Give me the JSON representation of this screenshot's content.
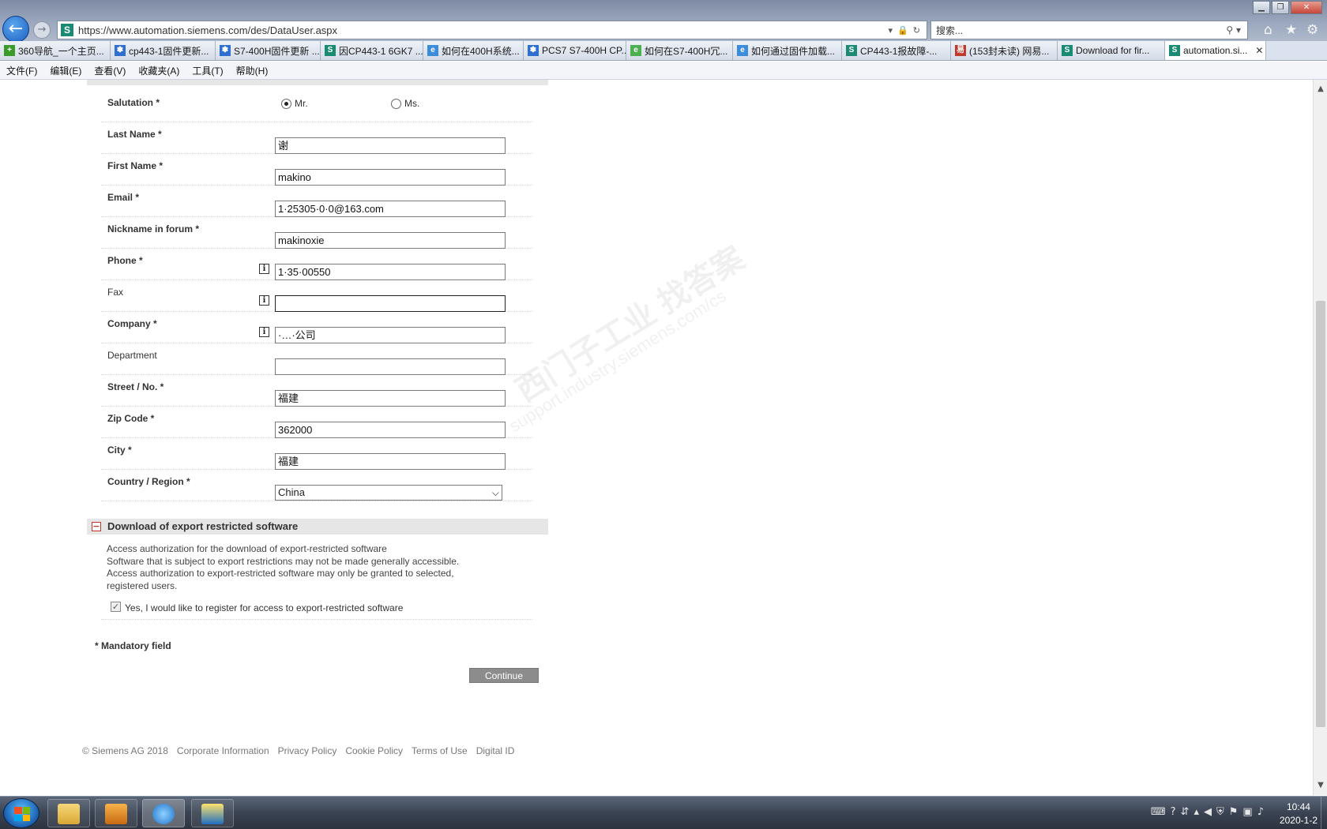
{
  "browser": {
    "url": "https://www.automation.siemens.com/des/DataUser.aspx",
    "search_placeholder": "搜索...",
    "tabs": [
      {
        "label": "360导航_一个主页...",
        "icon_color": "#3a9b2a",
        "icon_char": "+"
      },
      {
        "label": "cp443-1固件更新...",
        "icon_color": "#2f6fd0",
        "icon_char": "✽"
      },
      {
        "label": "S7-400H固件更新 ...",
        "icon_color": "#2f6fd0",
        "icon_char": "✽"
      },
      {
        "label": "因CP443-1 6GK7 ...",
        "icon_color": "#1b8a72",
        "icon_char": "S"
      },
      {
        "label": "如何在400H系统...",
        "icon_color": "#3a8ddd",
        "icon_char": "e"
      },
      {
        "label": "PCS7 S7-400H CP...",
        "icon_color": "#2f6fd0",
        "icon_char": "✽"
      },
      {
        "label": "如何在S7-400H冗...",
        "icon_color": "#4caf50",
        "icon_char": "e"
      },
      {
        "label": "如何通过固件加载...",
        "icon_color": "#3a8ddd",
        "icon_char": "e"
      },
      {
        "label": "CP443-1报故障-...",
        "icon_color": "#1b8a72",
        "icon_char": "S"
      },
      {
        "label": "(153封未读) 网易...",
        "icon_color": "#c0392b",
        "icon_char": "易"
      },
      {
        "label": "Download for fir...",
        "icon_color": "#1b8a72",
        "icon_char": "S"
      },
      {
        "label": "automation.si...",
        "icon_color": "#1b8a72",
        "icon_char": "S",
        "active": true
      }
    ],
    "menu": [
      "文件(F)",
      "编辑(E)",
      "查看(V)",
      "收藏夹(A)",
      "工具(T)",
      "帮助(H)"
    ]
  },
  "form": {
    "salutation": {
      "label": "Salutation *",
      "options": [
        "Mr.",
        "Ms."
      ],
      "selected": "Mr."
    },
    "last_name": {
      "label": "Last Name *",
      "value": "谢"
    },
    "first_name": {
      "label": "First Name *",
      "value": "makino"
    },
    "email": {
      "label": "Email *",
      "value": "1·25305·0·0@163.com"
    },
    "nickname": {
      "label": "Nickname in forum *",
      "value": "makinoxie"
    },
    "phone": {
      "label": "Phone *",
      "value": "1·35·00550"
    },
    "fax": {
      "label": "Fax",
      "value": ""
    },
    "company": {
      "label": "Company *",
      "value": "·…·公司"
    },
    "department": {
      "label": "Department",
      "value": ""
    },
    "street": {
      "label": "Street / No. *",
      "value": "福建"
    },
    "zip": {
      "label": "Zip Code *",
      "value": "362000"
    },
    "city": {
      "label": "City *",
      "value": "福建"
    },
    "country": {
      "label": "Country / Region *",
      "value": "China"
    }
  },
  "export": {
    "title": "Download of export restricted software",
    "lines": [
      "Access authorization for the download of export-restricted software",
      "Software that is subject to export restrictions may not be made generally accessible.",
      "Access authorization to export-restricted software may only be granted to selected,",
      "registered users."
    ],
    "checkbox_label": "Yes, I would like to register for access to export-restricted software",
    "checked": true
  },
  "mandatory_note": "* Mandatory field",
  "continue_label": "Continue",
  "footer": {
    "copyright": "© Siemens AG 2018",
    "links": [
      "Corporate Information",
      "Privacy Policy",
      "Cookie Policy",
      "Terms of Use",
      "Digital ID"
    ]
  },
  "watermark": {
    "line1": "西门子工业  找答案",
    "line2": "support.industry.siemens.com/cs"
  },
  "taskbar": {
    "time": "10:44",
    "date": "2020-1-2"
  }
}
